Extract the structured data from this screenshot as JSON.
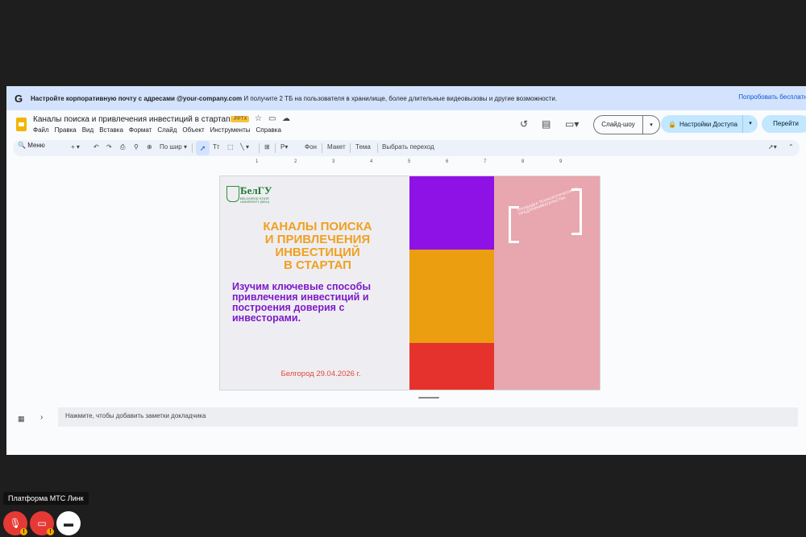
{
  "promo": {
    "logo": "G",
    "text_bold": "Настройте корпоративную почту с адресами @your-company.com",
    "text": "И получите 2 ТБ на пользователя в хранилище, более длительные видеовызовы и другие возможности.",
    "try_link": "Попробовать бесплатно"
  },
  "doc": {
    "title": "Каналы поиска и привлечения инвестиций в стартап",
    "badge": ".PPTX",
    "menus": [
      "Файл",
      "Правка",
      "Вид",
      "Вставка",
      "Формат",
      "Слайд",
      "Объект",
      "Инструменты",
      "Справка"
    ]
  },
  "header_actions": {
    "slideshow": "Слайд-шоу",
    "share": "Настройки Доступа",
    "go": "Перейти"
  },
  "toolbar": {
    "menu": "Меню",
    "zoom": "По шир",
    "background": "Фон",
    "layout": "Макет",
    "theme": "Тема",
    "transition": "Выбрать переход"
  },
  "ruler": [
    "1",
    "2",
    "3",
    "4",
    "5",
    "6",
    "7",
    "8",
    "9"
  ],
  "slide": {
    "logo_text": "БелГУ",
    "logo_small": "НИУ",
    "logo_sub": "BELGOROD STATE UNIVERSITY (BSU)",
    "title_lines": [
      "КАНАЛЫ ПОИСКА",
      "И ПРИВЛЕЧЕНИЯ",
      "ИНВЕСТИЦИЙ",
      "В СТАРТАП"
    ],
    "subtitle_lines": [
      "Изучим ключевые способы",
      "привлечения инвестиций и",
      "построения доверия с",
      "инвесторами."
    ],
    "date": "Белгород 29.04.2026 г.",
    "stamp": "ПЛОЩАДКА ТЕХНОЛОГИЧЕСКОГО ПРЕДПРИНИМАТЕЛЬСТВА",
    "colors": {
      "purple": "#8e12e6",
      "orange": "#ea9e10",
      "red": "#e5322c",
      "pink": "#e8a6ae"
    }
  },
  "notes": {
    "placeholder": "Нажмите, чтобы добавить заметки докладчика"
  },
  "meeting": {
    "platform": "Платформа МТС Линк",
    "warn": "!"
  }
}
